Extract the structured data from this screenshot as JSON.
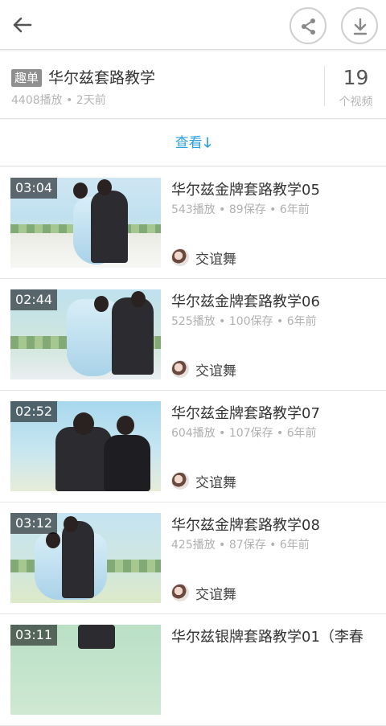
{
  "header": {
    "back_icon": "arrow-left-icon",
    "share_icon": "share-icon",
    "download_icon": "download-icon"
  },
  "album": {
    "tag": "趣单",
    "title": "华尔兹套路教学",
    "meta": "4408播放 • 2天前",
    "count": "19",
    "count_label": "个视频"
  },
  "view_more": {
    "label": "查看",
    "icon": "arrow-down-icon",
    "accent": "#2aa0e0"
  },
  "videos": [
    {
      "duration": "03:04",
      "title": "华尔兹金牌套路教学05",
      "meta": "543播放 • 89保存 • 6年前",
      "author": "交谊舞"
    },
    {
      "duration": "02:44",
      "title": "华尔兹金牌套路教学06",
      "meta": "525播放 • 100保存 • 6年前",
      "author": "交谊舞"
    },
    {
      "duration": "02:52",
      "title": "华尔兹金牌套路教学07",
      "meta": "604播放 • 107保存 • 6年前",
      "author": "交谊舞"
    },
    {
      "duration": "03:12",
      "title": "华尔兹金牌套路教学08",
      "meta": "425播放 • 87保存 • 6年前",
      "author": "交谊舞"
    },
    {
      "duration": "03:11",
      "title": "华尔兹银牌套路教学01（李春",
      "meta": "",
      "author": ""
    }
  ]
}
